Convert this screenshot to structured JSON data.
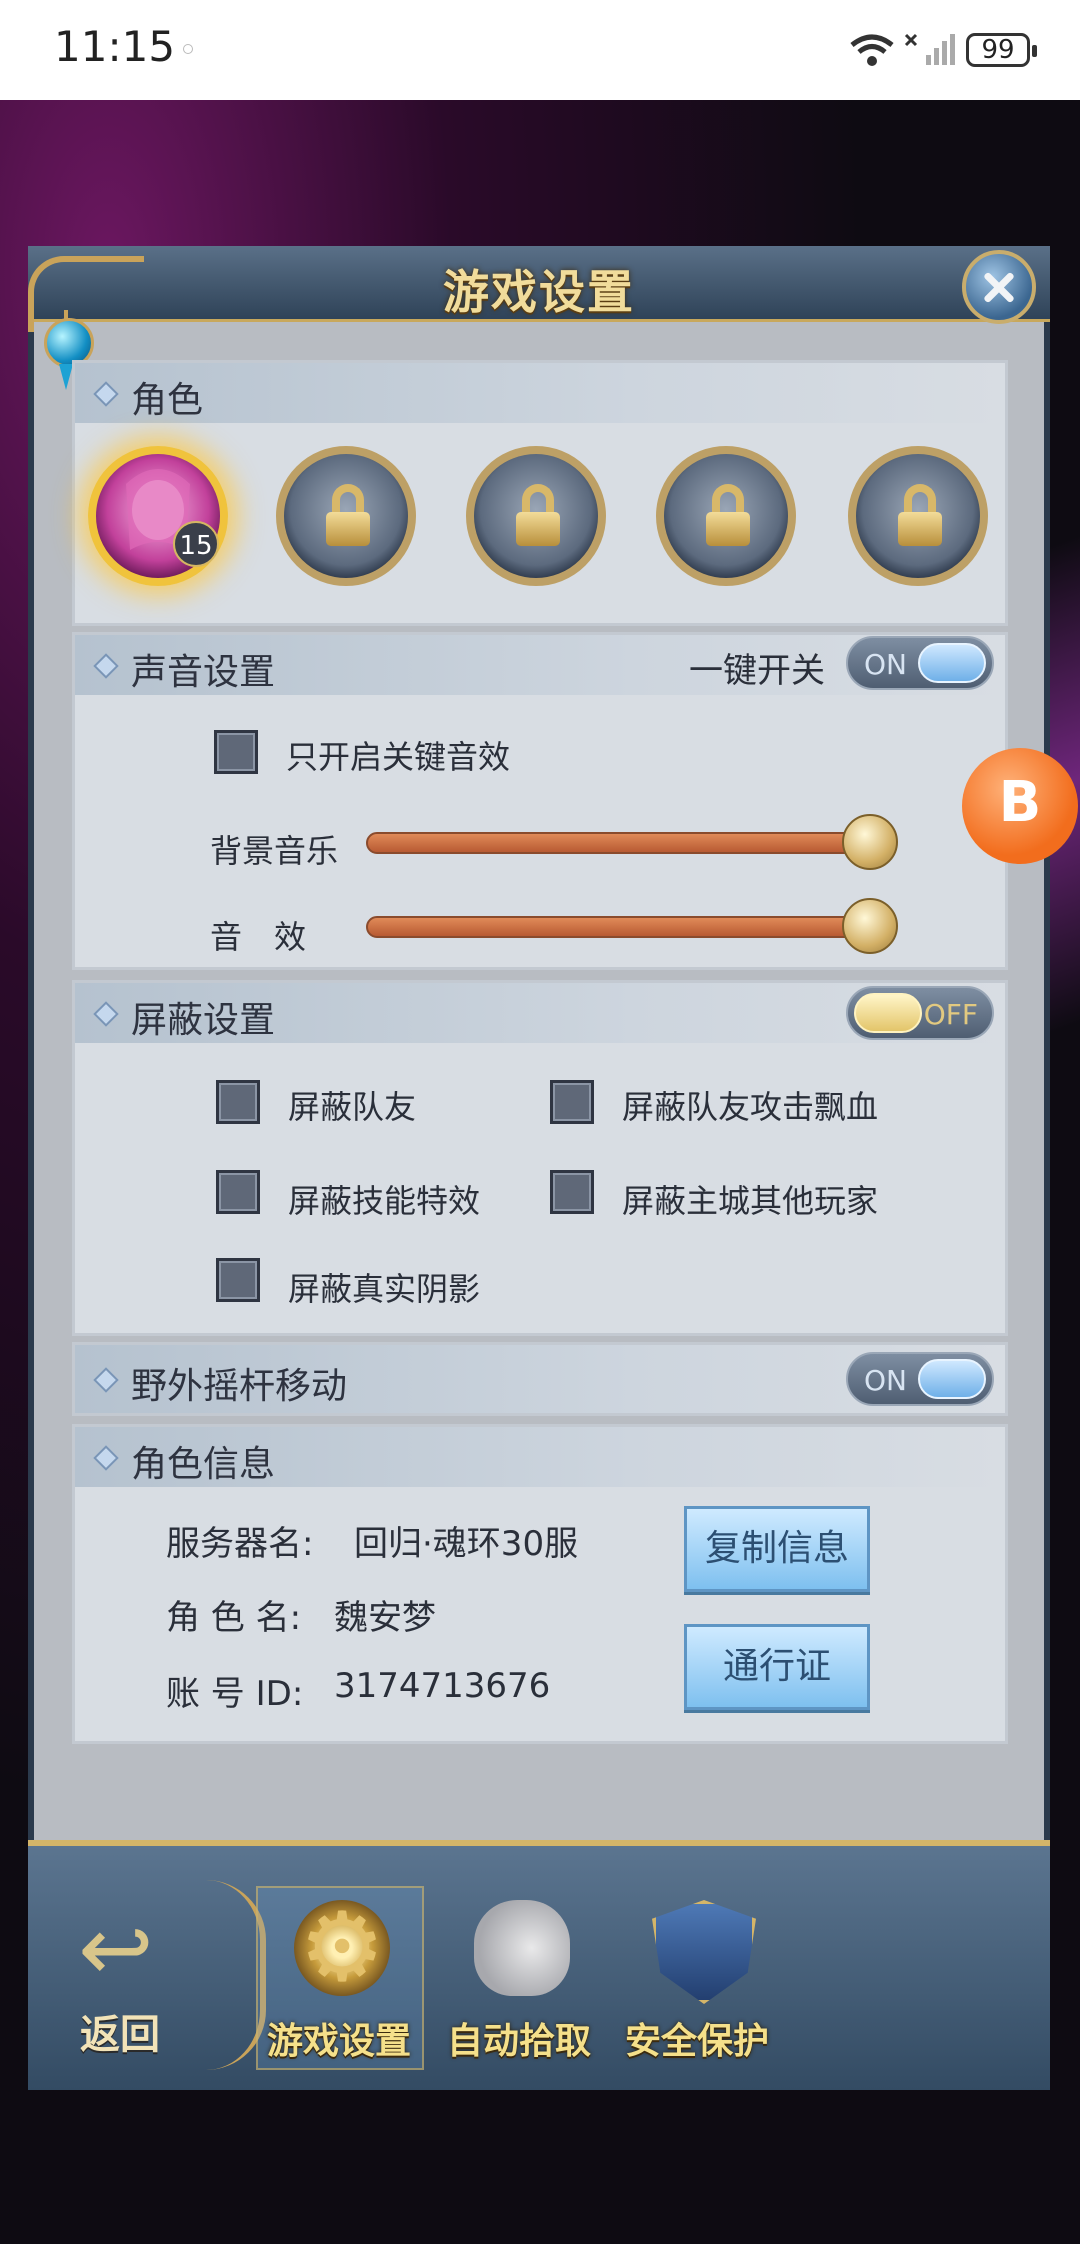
{
  "status_bar": {
    "time": "11:15",
    "battery": "99"
  },
  "dialog": {
    "title": "游戏设置"
  },
  "role_section": {
    "title": "角色",
    "active_role_level": "15",
    "locked_slots": 4
  },
  "sound_section": {
    "title": "声音设置",
    "master_toggle_label": "一键开关",
    "master_toggle_state": "ON",
    "key_sfx_only_label": "只开启关键音效",
    "key_sfx_only_checked": false,
    "bgm_label": "背景音乐",
    "bgm_level": 1.0,
    "sfx_label": "音　效",
    "sfx_level": 1.0
  },
  "block_section": {
    "title": "屏蔽设置",
    "toggle_state": "OFF",
    "options": [
      {
        "label": "屏蔽队友",
        "checked": false
      },
      {
        "label": "屏蔽队友攻击飘血",
        "checked": false
      },
      {
        "label": "屏蔽技能特效",
        "checked": false
      },
      {
        "label": "屏蔽主城其他玩家",
        "checked": false
      },
      {
        "label": "屏蔽真实阴影",
        "checked": false
      }
    ]
  },
  "joystick_section": {
    "title": "野外摇杆移动",
    "toggle_state": "ON"
  },
  "info_section": {
    "title": "角色信息",
    "server_label": "服务器名:",
    "server_value": "回归·魂环30服",
    "role_label": "角 色 名:",
    "role_value": "魏安梦",
    "account_label": "账 号 ID:",
    "account_value": "3174713676",
    "copy_button": "复制信息",
    "pass_button": "通行证"
  },
  "bottom_nav": {
    "back": "返回",
    "tabs": [
      "游戏设置",
      "自动拾取",
      "安全保护"
    ],
    "active_tab": "游戏设置"
  },
  "float_badge": "B"
}
